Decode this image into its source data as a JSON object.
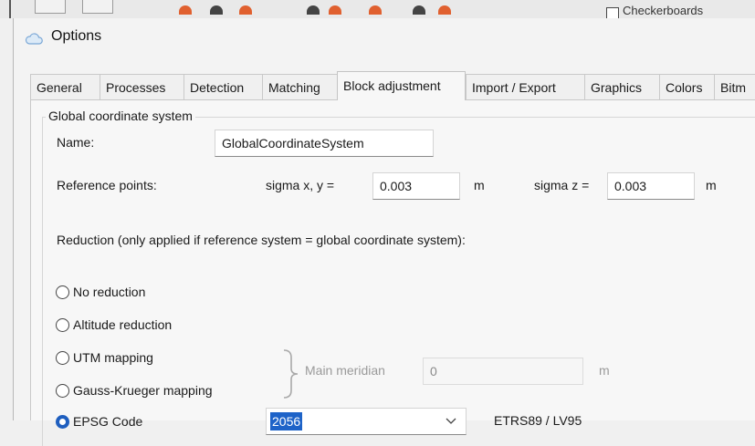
{
  "background": {
    "checkbox_label": "Checkerboards"
  },
  "window": {
    "title": "Options"
  },
  "tabs": [
    {
      "label": "General"
    },
    {
      "label": "Processes"
    },
    {
      "label": "Detection"
    },
    {
      "label": "Matching"
    },
    {
      "label": "Block adjustment",
      "active": true
    },
    {
      "label": "Import / Export"
    },
    {
      "label": "Graphics"
    },
    {
      "label": "Colors"
    },
    {
      "label": "Bitm"
    }
  ],
  "group": {
    "title": "Global coordinate system",
    "name_label": "Name:",
    "name_value": "GlobalCoordinateSystem",
    "ref_label": "Reference points:",
    "sigma_xy_label": "sigma x, y =",
    "sigma_xy_value": "0.003",
    "sigma_xy_unit": "m",
    "sigma_z_label": "sigma z =",
    "sigma_z_value": "0.003",
    "sigma_z_unit": "m",
    "reduction_label": "Reduction (only applied if reference system = global coordinate system):",
    "options": {
      "no_reduction": "No reduction",
      "altitude": "Altitude reduction",
      "utm": "UTM mapping",
      "gauss": "Gauss-Krueger mapping",
      "epsg": "EPSG Code"
    },
    "selected_option": "epsg",
    "meridian_label": "Main meridian",
    "meridian_value": "0",
    "meridian_unit": "m",
    "epsg_value": "2056",
    "epsg_description": "ETRS89 / LV95"
  },
  "colors": {
    "accent": "#1e63c8",
    "radio_checked": "#1f5fbf"
  },
  "icons": {
    "app": "cloud-icon",
    "dropdown": "chevron-down-icon",
    "brace": "brace-icon"
  }
}
